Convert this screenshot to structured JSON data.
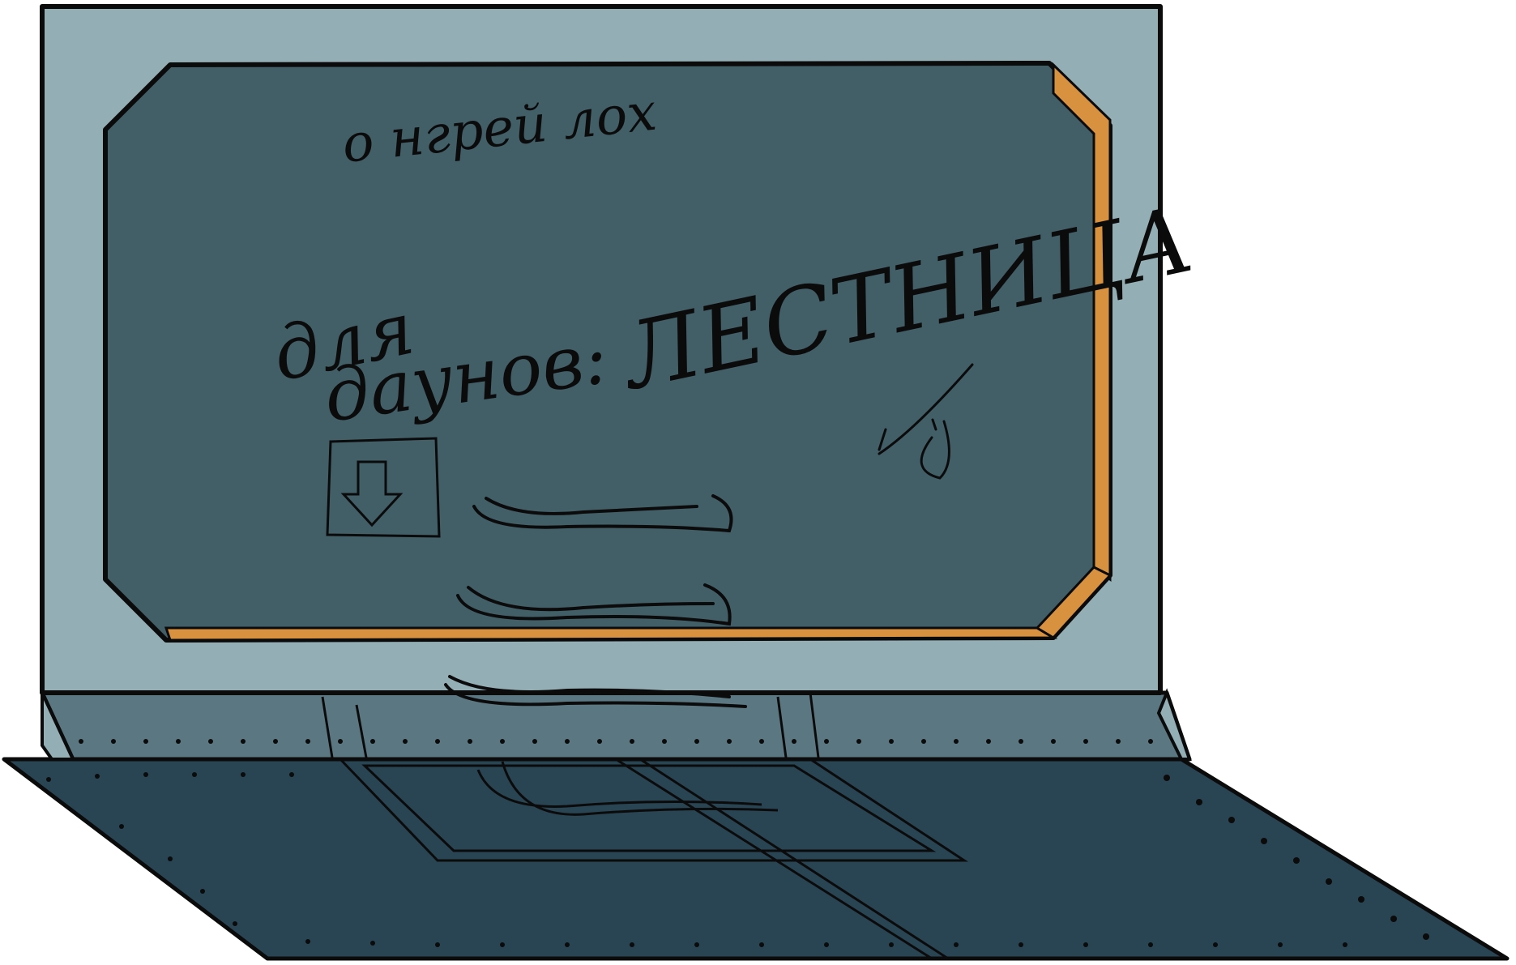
{
  "screen": {
    "line1": "о нгрей лох",
    "line2_word1": "для",
    "line2_word2": "даунов:",
    "line2_word3": "ЛЕСТНИЦА"
  },
  "colors": {
    "bezel": "#93afb5",
    "screen": "#425f68",
    "accent": "#d8913f",
    "hinge": "#5b7882",
    "keyboard": "#294553",
    "ink": "#0b0b0b"
  },
  "icons": {
    "download": "download-box-icon",
    "face": "smiley-doodle-icon"
  }
}
